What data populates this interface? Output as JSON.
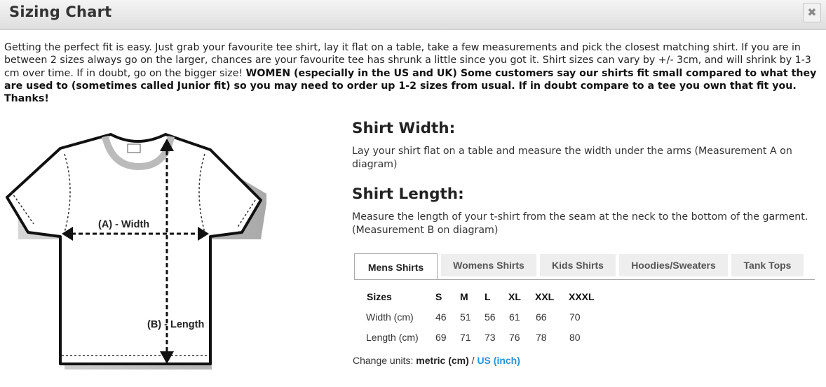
{
  "dialog": {
    "title": "Sizing Chart",
    "close_label": "✖"
  },
  "intro": {
    "text": "Getting the perfect fit is easy. Just grab your favourite tee shirt, lay it flat on a table, take a few measurements and pick the closest matching shirt. If you are in between 2 sizes always go on the larger, chances are your favourite tee has shrunk a little since you got it. Shirt sizes can vary by +/- 3cm, and will shrink by 1-3 cm over time. If in doubt, go on the bigger size! ",
    "bold_text": "WOMEN (especially in the US and UK) Some customers say our shirts fit small compared to what they are used to (sometimes called Junior fit) so you may need to order up 1-2 sizes from usual. If in doubt compare to a tee you own that fit you. Thanks!"
  },
  "diagram": {
    "width_label": "(A) - Width",
    "length_label": "(B) - Length"
  },
  "shirt_width": {
    "title": "Shirt Width:",
    "text": "Lay your shirt flat on a table and measure the width under the arms (Measurement A on diagram)"
  },
  "shirt_length": {
    "title": "Shirt Length:",
    "text": "Measure the length of your t-shirt from the seam at the neck to the bottom of the garment. (Measurement B on diagram)"
  },
  "tabs": [
    "Mens Shirts",
    "Womens Shirts",
    "Kids Shirts",
    "Hoodies/Sweaters",
    "Tank Tops"
  ],
  "active_tab": "Mens Shirts",
  "size_table": {
    "header": [
      "Sizes",
      "S",
      "M",
      "L",
      "XL",
      "XXL",
      "XXXL"
    ],
    "rows": [
      [
        "Width (cm)",
        "46",
        "51",
        "56",
        "61",
        "66",
        "70"
      ],
      [
        "Length (cm)",
        "69",
        "71",
        "73",
        "76",
        "78",
        "80"
      ]
    ]
  },
  "units": {
    "label": "Change units:",
    "metric": "metric (cm)",
    "separator": "/",
    "us": "US (inch)"
  }
}
